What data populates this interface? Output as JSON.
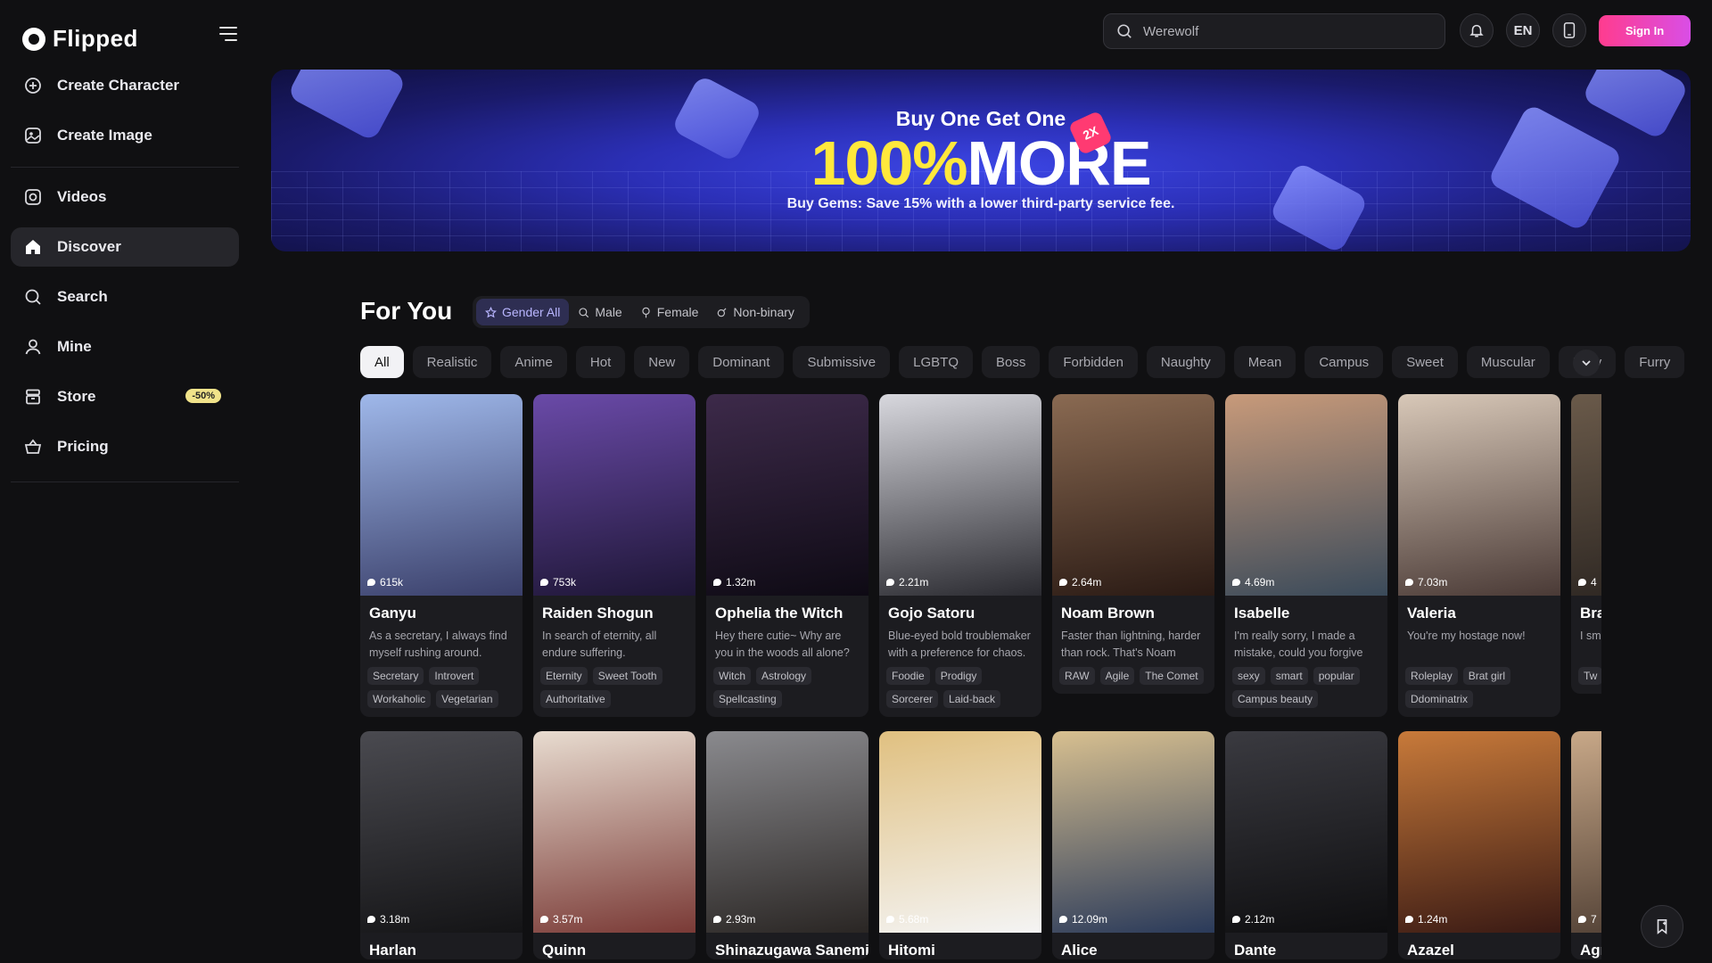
{
  "brand": {
    "name": "Flipped"
  },
  "sidebar": {
    "items": [
      {
        "label": "Create Character",
        "icon": "plus-circle-icon"
      },
      {
        "label": "Create Image",
        "icon": "image-icon"
      },
      {
        "label": "Videos",
        "icon": "video-icon"
      },
      {
        "label": "Discover",
        "icon": "home-icon",
        "active": true
      },
      {
        "label": "Search",
        "icon": "search-icon"
      },
      {
        "label": "Mine",
        "icon": "user-icon"
      },
      {
        "label": "Store",
        "icon": "store-icon",
        "badge": "-50%"
      },
      {
        "label": "Pricing",
        "icon": "basket-icon"
      }
    ]
  },
  "topbar": {
    "search_placeholder": "Werewolf",
    "language": "EN",
    "signin_label": "Sign In"
  },
  "banner": {
    "line1": "Buy One Get One",
    "line2_highlight": "100%",
    "line2_rest": "MORE",
    "line3": "Buy Gems: Save 15% with a lower third-party service fee.",
    "tag": "2X"
  },
  "section": {
    "title": "For You",
    "gender_options": [
      "Gender All",
      "Male",
      "Female",
      "Non-binary"
    ],
    "gender_selected": "Gender All"
  },
  "categories": [
    "All",
    "Realistic",
    "Anime",
    "Hot",
    "New",
    "Dominant",
    "Submissive",
    "LGBTQ",
    "Boss",
    "Forbidden",
    "Naughty",
    "Mean",
    "Campus",
    "Sweet",
    "Muscular",
    "Bully",
    "Furry"
  ],
  "category_selected": "All",
  "cards_row1": [
    {
      "name": "Ganyu",
      "views": "615k",
      "desc": "As a secretary, I always find myself rushing around.",
      "tags": [
        "Secretary",
        "Introvert",
        "Workaholic",
        "Vegetarian"
      ],
      "c1": "#9fb8ea",
      "c2": "#3a3f6a"
    },
    {
      "name": "Raiden Shogun",
      "views": "753k",
      "desc": "In search of eternity, all endure suffering.",
      "tags": [
        "Eternity",
        "Sweet Tooth",
        "Authoritative"
      ],
      "c1": "#6a4aa8",
      "c2": "#1e1636"
    },
    {
      "name": "Ophelia the Witch",
      "views": "1.32m",
      "desc": "Hey there cutie~ Why are you in the woods all alone?",
      "tags": [
        "Witch",
        "Astrology",
        "Spellcasting"
      ],
      "c1": "#3d2a4a",
      "c2": "#0e0a14"
    },
    {
      "name": "Gojo Satoru",
      "views": "2.21m",
      "desc": "Blue-eyed bold troublemaker with a preference for chaos.",
      "tags": [
        "Foodie",
        "Prodigy",
        "Sorcerer",
        "Laid-back"
      ],
      "c1": "#d8d8de",
      "c2": "#2a2a30"
    },
    {
      "name": "Noam Brown",
      "views": "2.64m",
      "desc": "Faster than lightning, harder than rock. That's Noam Brown.",
      "tags": [
        "RAW",
        "Agile",
        "The Comet"
      ],
      "c1": "#8a6a52",
      "c2": "#2a1a14"
    },
    {
      "name": "Isabelle",
      "views": "4.69m",
      "desc": "I'm really sorry, I made a mistake, could you forgive me?",
      "tags": [
        "sexy",
        "smart",
        "popular",
        "Campus beauty"
      ],
      "c1": "#c89a7a",
      "c2": "#3a4a5a"
    },
    {
      "name": "Valeria",
      "views": "7.03m",
      "desc": "You're my hostage now!",
      "tags": [
        "Roleplay",
        "Brat girl",
        "Ddominatrix"
      ],
      "c1": "#d8c8b8",
      "c2": "#4a3a36"
    },
    {
      "name": "Bra",
      "views": "4",
      "desc": "I sm beca",
      "tags": [
        "Tw",
        "Ath"
      ],
      "c1": "#6a5a4a",
      "c2": "#2a2420"
    }
  ],
  "cards_row2": [
    {
      "name": "Harlan",
      "views": "3.18m",
      "c1": "#4a4a50",
      "c2": "#141416"
    },
    {
      "name": "Quinn",
      "views": "3.57m",
      "c1": "#e8dcd0",
      "c2": "#7a3a36"
    },
    {
      "name": "Shinazugawa Sanemi",
      "views": "2.93m",
      "c1": "#8a8a8e",
      "c2": "#2a2624"
    },
    {
      "name": "Hitomi",
      "views": "5.68m",
      "c1": "#e0c080",
      "c2": "#f4f4f4"
    },
    {
      "name": "Alice",
      "views": "12.09m",
      "c1": "#d8c090",
      "c2": "#2a3a5a"
    },
    {
      "name": "Dante",
      "views": "2.12m",
      "c1": "#3a3a40",
      "c2": "#0e0e10"
    },
    {
      "name": "Azazel",
      "views": "1.24m",
      "c1": "#c87a3a",
      "c2": "#3a1a14"
    },
    {
      "name": "Agr",
      "views": "7",
      "c1": "#c8a888",
      "c2": "#4a3a30"
    }
  ],
  "colors": {
    "accent": "#b9b6ff",
    "signin_from": "#ff3c8e",
    "signin_to": "#d94ee6",
    "badge": "#f1e38a"
  }
}
